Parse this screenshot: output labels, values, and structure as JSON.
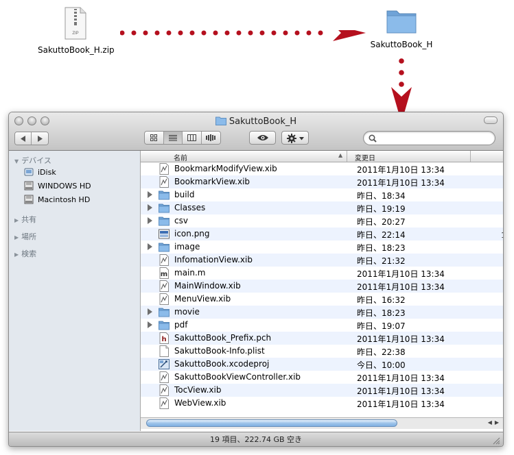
{
  "zip": {
    "label": "SakuttoBook_H.zip",
    "badge": "ZIP"
  },
  "folder": {
    "label": "SakuttoBook_H"
  },
  "window": {
    "title": "SakuttoBook_H",
    "status": "19 項目、222.74 GB 空き"
  },
  "sidebar": {
    "devices_label": "デバイス",
    "devices": [
      {
        "label": "iDisk",
        "icon": "idisk-icon"
      },
      {
        "label": "WINDOWS HD",
        "icon": "hard-drive-icon"
      },
      {
        "label": "Macintosh HD",
        "icon": "hard-drive-icon"
      }
    ],
    "shared_label": "共有",
    "places_label": "場所",
    "search_label": "検索"
  },
  "columns": {
    "name": "名前",
    "date": "変更日"
  },
  "files": [
    {
      "name": "BookmarkModifyView.xib",
      "date": "2011年1月10日 13:34",
      "type": "xib",
      "folder": false
    },
    {
      "name": "BookmarkView.xib",
      "date": "2011年1月10日 13:34",
      "type": "xib",
      "folder": false
    },
    {
      "name": "build",
      "date": "昨日、18:34",
      "type": "folder",
      "folder": true
    },
    {
      "name": "Classes",
      "date": "昨日、19:19",
      "type": "folder",
      "folder": true
    },
    {
      "name": "csv",
      "date": "昨日、20:27",
      "type": "folder",
      "folder": true
    },
    {
      "name": "icon.png",
      "date": "昨日、22:14",
      "type": "png",
      "folder": false
    },
    {
      "name": "image",
      "date": "昨日、18:23",
      "type": "folder",
      "folder": true
    },
    {
      "name": "InfomationView.xib",
      "date": "昨日、21:32",
      "type": "xib",
      "folder": false
    },
    {
      "name": "main.m",
      "date": "2011年1月10日 13:34",
      "type": "m",
      "folder": false
    },
    {
      "name": "MainWindow.xib",
      "date": "2011年1月10日 13:34",
      "type": "xib",
      "folder": false
    },
    {
      "name": "MenuView.xib",
      "date": "昨日、16:32",
      "type": "xib",
      "folder": false
    },
    {
      "name": "movie",
      "date": "昨日、18:23",
      "type": "folder",
      "folder": true
    },
    {
      "name": "pdf",
      "date": "昨日、19:07",
      "type": "folder",
      "folder": true
    },
    {
      "name": "SakuttoBook_Prefix.pch",
      "date": "2011年1月10日 13:34",
      "type": "h",
      "folder": false
    },
    {
      "name": "SakuttoBook-Info.plist",
      "date": "昨日、22:38",
      "type": "plist",
      "folder": false
    },
    {
      "name": "SakuttoBook.xcodeproj",
      "date": "今日、10:00",
      "type": "xcodeproj",
      "folder": false
    },
    {
      "name": "SakuttoBookViewController.xib",
      "date": "2011年1月10日 13:34",
      "type": "xib",
      "folder": false
    },
    {
      "name": "TocView.xib",
      "date": "2011年1月10日 13:34",
      "type": "xib",
      "folder": false
    },
    {
      "name": "WebView.xib",
      "date": "2011年1月10日 13:34",
      "type": "xib",
      "folder": false
    }
  ],
  "colors": {
    "arrow": "#b5101e",
    "folder": "#7fb2e5",
    "row_alt": "#edf3fe",
    "sidebar": "#e3e8ee"
  }
}
